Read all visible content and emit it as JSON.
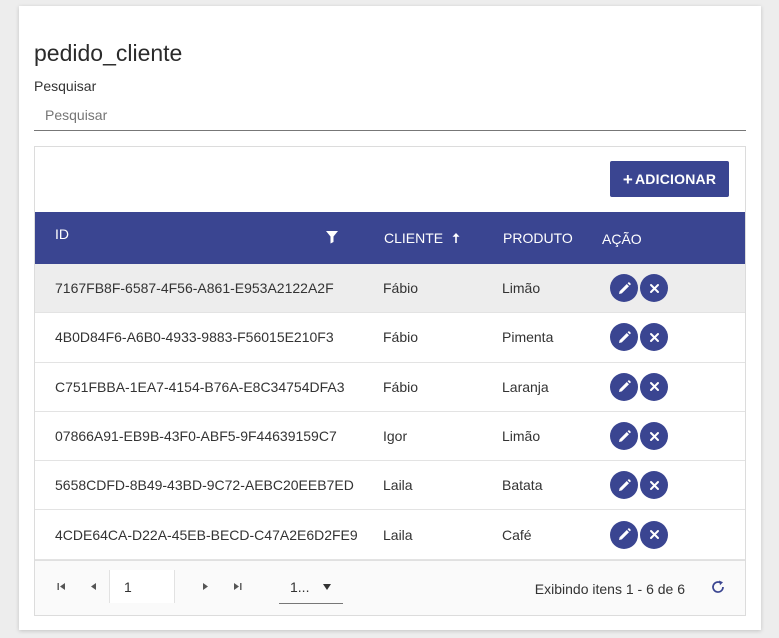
{
  "page": {
    "title": "pedido_cliente",
    "search_label": "Pesquisar",
    "search_placeholder": "Pesquisar",
    "search_value": ""
  },
  "toolbar": {
    "add_label": "ADICIONAR",
    "add_plus": "+"
  },
  "table": {
    "headers": {
      "id": "ID",
      "cliente": "CLIENTE",
      "produto": "PRODUTO",
      "acao": "AÇÃO"
    },
    "rows": [
      {
        "id": "7167FB8F-6587-4F56-A861-E953A2122A2F",
        "cliente": "Fábio",
        "produto": "Limão"
      },
      {
        "id": "4B0D84F6-A6B0-4933-9883-F56015E210F3",
        "cliente": "Fábio",
        "produto": "Pimenta"
      },
      {
        "id": "C751FBBA-1EA7-4154-B76A-E8C34754DFA3",
        "cliente": "Fábio",
        "produto": "Laranja"
      },
      {
        "id": "07866A91-EB9B-43F0-ABF5-9F44639159C7",
        "cliente": "Igor",
        "produto": "Limão"
      },
      {
        "id": "5658CDFD-8B49-43BD-9C72-AEBC20EEB7ED",
        "cliente": "Laila",
        "produto": "Batata"
      },
      {
        "id": "4CDE64CA-D22A-45EB-BECD-C47A2E6D2FE9",
        "cliente": "Laila",
        "produto": "Café"
      }
    ]
  },
  "pager": {
    "current_page": "1",
    "page_size": "1...",
    "info": "Exibindo itens 1 - 6 de 6"
  },
  "colors": {
    "accent": "#3a4591",
    "selected_row": "#ededed"
  },
  "icons": [
    "filter-icon",
    "sort-asc-icon",
    "edit-icon",
    "delete-icon",
    "first-page-icon",
    "prev-page-icon",
    "next-page-icon",
    "last-page-icon",
    "refresh-icon"
  ]
}
